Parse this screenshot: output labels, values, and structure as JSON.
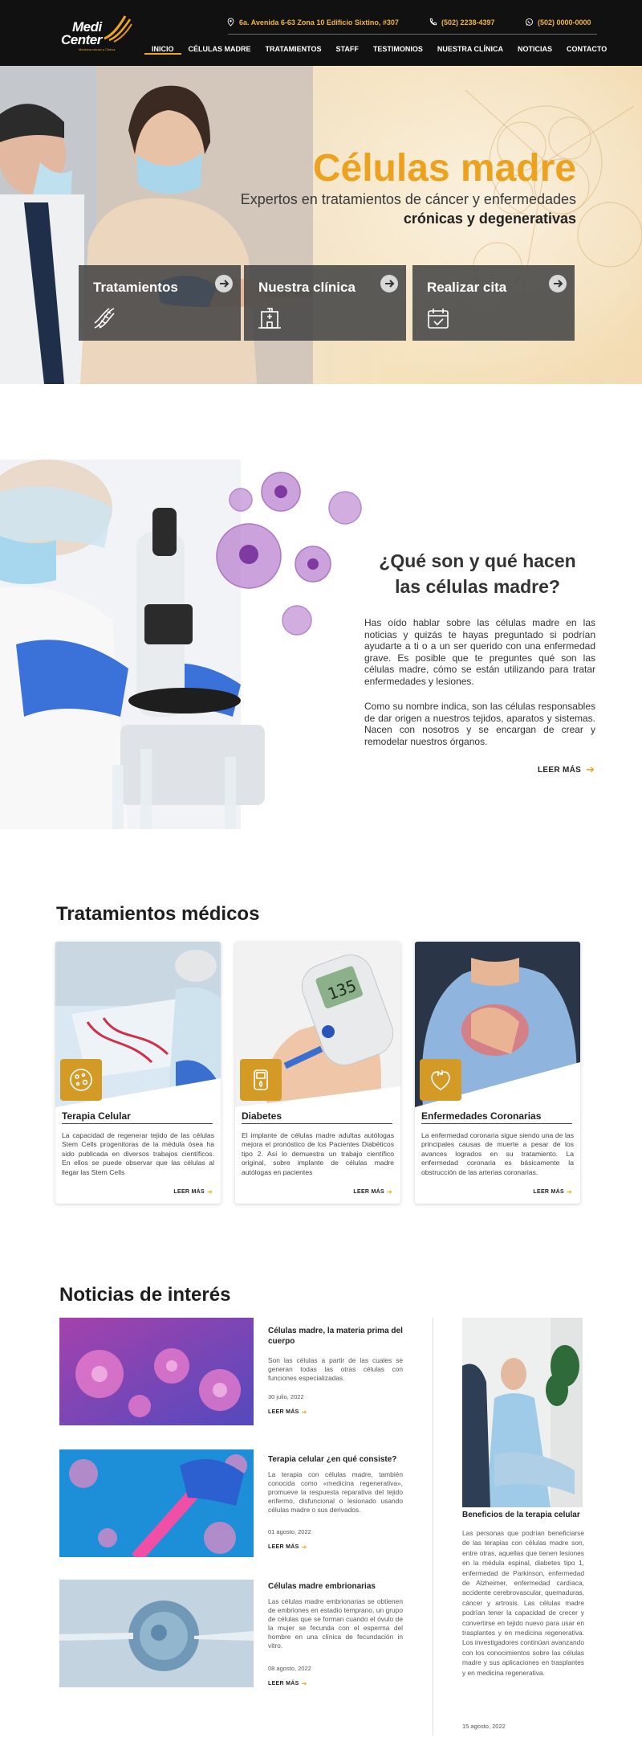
{
  "header": {
    "logo": {
      "line1": "Medi",
      "line2": "Center",
      "tagline": "Medicina celular y Clínica"
    },
    "address": "6a. Avenida 6-63 Zona 10 Edificio Sixtino, #307",
    "phone": "(502) 2238-4397",
    "whatsapp": "(502) 0000-0000",
    "nav": [
      "INICIO",
      "CÉLULAS MADRE",
      "TRATAMIENTOS",
      "STAFF",
      "TESTIMONIOS",
      "NUESTRA CLÍNICA",
      "NOTICIAS",
      "CONTACTO"
    ],
    "active_nav": "INICIO"
  },
  "hero": {
    "title": "Células madre",
    "subtitle_line1": "Expertos en tratamientos de cáncer y enfermedades",
    "subtitle_line2": "crónicas y degenerativas",
    "cards": [
      {
        "label": "Tratamientos",
        "icon": "dna-icon"
      },
      {
        "label": "Nuestra clínica",
        "icon": "hospital-icon"
      },
      {
        "label": "Realizar cita",
        "icon": "calendar-check-icon"
      }
    ]
  },
  "about": {
    "title_line1": "¿Qué son y qué hacen",
    "title_line2": "las células madre?",
    "paragraph1": "Has oído hablar sobre las células madre en las noticias y quizás te hayas preguntado si podrían ayudarte a ti o a un ser querido con una enfermedad grave. Es posible que te preguntes qué son las células madre, cómo se están utilizando para tratar enfermedades y lesiones.",
    "paragraph2": "Como su nombre indica, son las células responsables de dar origen a nuestros tejidos, aparatos y sistemas. Nacen con nosotros y se encargan de crear y remodelar nuestros órganos.",
    "read_more": "LEER MÁS"
  },
  "treatments": {
    "title": "Tratamientos médicos",
    "items": [
      {
        "title": "Terapia Celular",
        "text": "La capacidad de regenerar tejido de las células Stem Cells progenitoras de la médula ósea ha sido publicada en diversos trabajos científicos. En ellos se puede observar que las células al llegar las Stem Cells",
        "read_more": "LEER MÁS",
        "icon": "cell-dish-icon"
      },
      {
        "title": "Diabetes",
        "text": "El implante de células madre adultas autólogas mejora el pronóstico de los Pacientes Diabéticos tipo 2. Así lo demuestra un trabajo científico original, sobre implante de células madre autólogas en pacientes",
        "read_more": "LEER MÁS",
        "icon": "glucometer-icon",
        "glucometer_reading": "135"
      },
      {
        "title": "Enfermedades Coronarias",
        "text": "La enfermedad coronaria sigue siendo una de las principales causas de muerte a pesar de los avances logrados en su tratamiento. La enfermedad coronaria es básicamente la obstrucción de las arterias coronarias.",
        "read_more": "LEER MÁS",
        "icon": "heart-icon"
      }
    ]
  },
  "news": {
    "title": "Noticias de interés",
    "items": [
      {
        "title": "Células madre, la materia prima del cuerpo",
        "text": "Son las células a partir de las cuales se generan todas las otras células con funciones especializadas.",
        "date": "30 julio, 2022",
        "read_more": "LEER MÁS"
      },
      {
        "title": "Terapia celular ¿en qué consiste?",
        "text": "La terapia con células madre, también conocida como «medicina regenerativa», promueve la respuesta reparativa del tejido enfermo, disfuncional o lesionado usando células madre o sus derivados.",
        "date": "01 agosto, 2022",
        "read_more": "LEER MÁS"
      },
      {
        "title": "Células madre embrionarias",
        "text": "Las células madre embrionarias se obtienen de embriones en estadio temprano, un grupo de células que se forman cuando el óvulo de la mujer se fecunda con el esperma del hombre en una clínica de fecundación in vitro.",
        "date": "08 agosto, 2022",
        "read_more": "LEER MÁS"
      }
    ],
    "featured": {
      "title": "Beneficios de la terapia celular",
      "text": "Las personas que podrían beneficiarse de las terapias con células madre son, entre otras, aquellas que tienen lesiones en la médula espinal, diabetes tipo 1, enfermedad de Parkinson, enfermedad de Alzheimer, enfermedad cardíaca, accidente cerebrovascular, quemaduras, cáncer y artrosis. Las células madre podrían tener la capacidad de crecer y convertirse en tejido nuevo para usar en trasplantes y en medicina regenerativa. Los investigadores continúan avanzando con los conocimientos sobre las células madre y sus aplicaciones en trasplantes y en medicina regenerativa.",
      "date": "15 agosto, 2022"
    }
  },
  "colors": {
    "accent": "#f0a51d",
    "header_bg": "#111111",
    "card_overlay": "#464646",
    "badge": "#d39a25"
  }
}
